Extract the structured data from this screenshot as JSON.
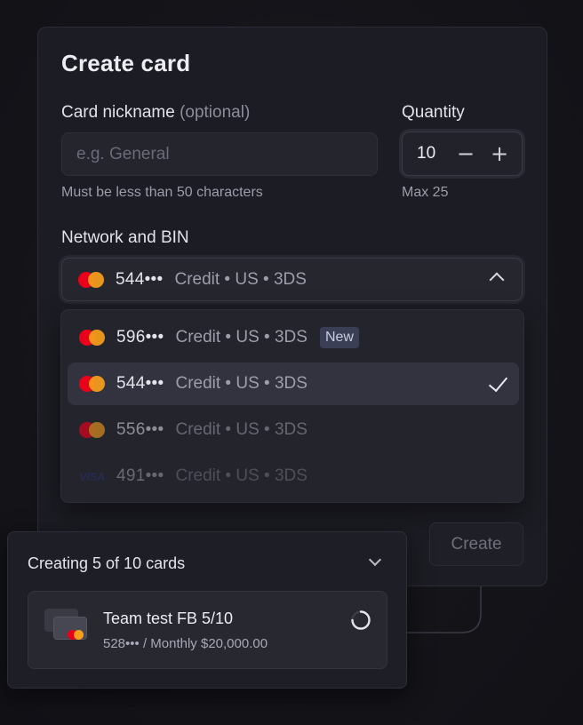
{
  "form": {
    "title": "Create card",
    "nickname": {
      "label": "Card nickname",
      "label_optional": "(optional)",
      "placeholder": "e.g. General",
      "value": "",
      "hint": "Must be less than 50 characters"
    },
    "quantity": {
      "label": "Quantity",
      "value": "10",
      "decrement": "−",
      "increment": "+",
      "hint": "Max 25"
    },
    "network": {
      "label": "Network and BIN",
      "selected": {
        "network": "mastercard-icon",
        "bin": "544•••",
        "meta": "Credit • US • 3DS"
      },
      "options": [
        {
          "network": "mastercard-icon",
          "bin": "596•••",
          "meta": "Credit • US • 3DS",
          "badge": "New"
        },
        {
          "network": "mastercard-icon",
          "bin": "544•••",
          "meta": "Credit • US • 3DS",
          "selected": true
        },
        {
          "network": "mastercard-icon",
          "bin": "556•••",
          "meta": "Credit • US • 3DS"
        },
        {
          "network": "visa-icon",
          "network_text": "VISA",
          "bin": "491•••",
          "meta": "Credit • US • 3DS"
        }
      ]
    },
    "create_label": "Create"
  },
  "progress": {
    "heading": "Creating 5 of 10 cards",
    "job": {
      "name": "Team test FB 5/10",
      "detail": "528••• / Monthly $20,000.00"
    }
  },
  "colors": {
    "mastercard_red": "#eb001b",
    "mastercard_yellow": "#f79e1b",
    "visa_blue": "#2d3a8f",
    "badge_bg": "#3b3f56"
  }
}
